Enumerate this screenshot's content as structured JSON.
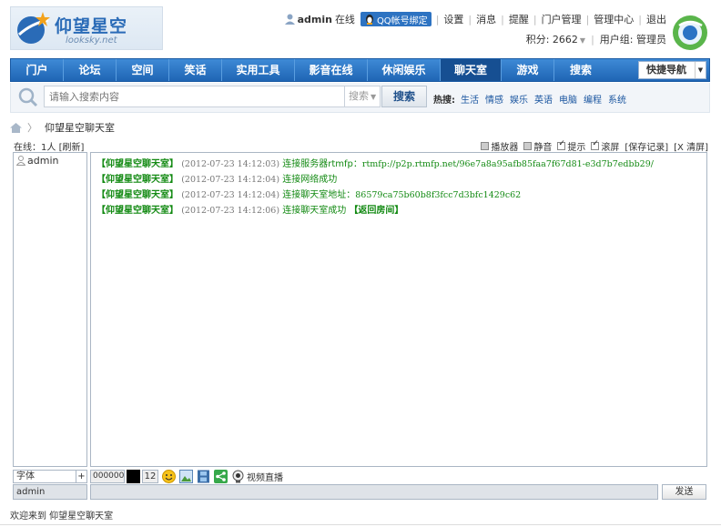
{
  "site": {
    "logo_cn": "仰望星空",
    "logo_en": "looksky.net"
  },
  "userbar": {
    "username": "admin",
    "status": "在线",
    "qq_bind": "QQ帐号绑定",
    "links": [
      "设置",
      "消息",
      "提醒",
      "门户管理",
      "管理中心",
      "退出"
    ],
    "points_label": "积分: 2662",
    "group_label": "用户组: 管理员"
  },
  "nav": {
    "items": [
      "门户",
      "论坛",
      "空间",
      "笑话",
      "实用工具",
      "影音在线",
      "休闲娱乐",
      "聊天室",
      "游戏",
      "搜索"
    ],
    "active": "聊天室",
    "quick_nav": "快捷导航"
  },
  "search": {
    "placeholder": "请输入搜索内容",
    "type": "搜索",
    "button": "搜索",
    "hot_label": "热搜:",
    "hot_items": [
      "生活",
      "情感",
      "娱乐",
      "英语",
      "电脑",
      "编程",
      "系统"
    ]
  },
  "breadcrumb": {
    "current": "仰望星空聊天室"
  },
  "online": {
    "label": "在线：1人",
    "refresh": "[刷新]"
  },
  "toolbar": {
    "player": "播放器",
    "mute": "静音",
    "notify": "提示",
    "scroll": "滚屏",
    "save": "[保存记录]",
    "clear": "[X 清屏]"
  },
  "users": [
    "admin"
  ],
  "messages": [
    {
      "from": "【仰望星空聊天室】",
      "time": "(2012-07-23 14:12:03)",
      "text": "连接服务器rtmfp：",
      "url": "rtmfp://p2p.rtmfp.net/96e7a8a95afb85faa7f67d81-e3d7b7edbb29/",
      "suffix": ""
    },
    {
      "from": "【仰望星空聊天室】",
      "time": "(2012-07-23 14:12:04)",
      "text": "连接网络成功",
      "url": "",
      "suffix": ""
    },
    {
      "from": "【仰望星空聊天室】",
      "time": "(2012-07-23 14:12:04)",
      "text": "连接聊天室地址：",
      "url": "86579ca75b60b8f3fcc7d3bfc1429c62",
      "suffix": ""
    },
    {
      "from": "【仰望星空聊天室】",
      "time": "(2012-07-23 14:12:06)",
      "text": "连接聊天室成功 ",
      "url": "",
      "suffix": "【返回房间】"
    }
  ],
  "input": {
    "font_label": "字体",
    "font_plus": "+",
    "color_value": "000000",
    "size_value": "12",
    "video_label": "视频直播",
    "name": "admin",
    "send": "发送"
  },
  "footer": {
    "welcome": "欢迎来到 仰望星空聊天室"
  },
  "colors": {
    "nav_blue": "#2a73c4",
    "message_green": "#138a13"
  }
}
